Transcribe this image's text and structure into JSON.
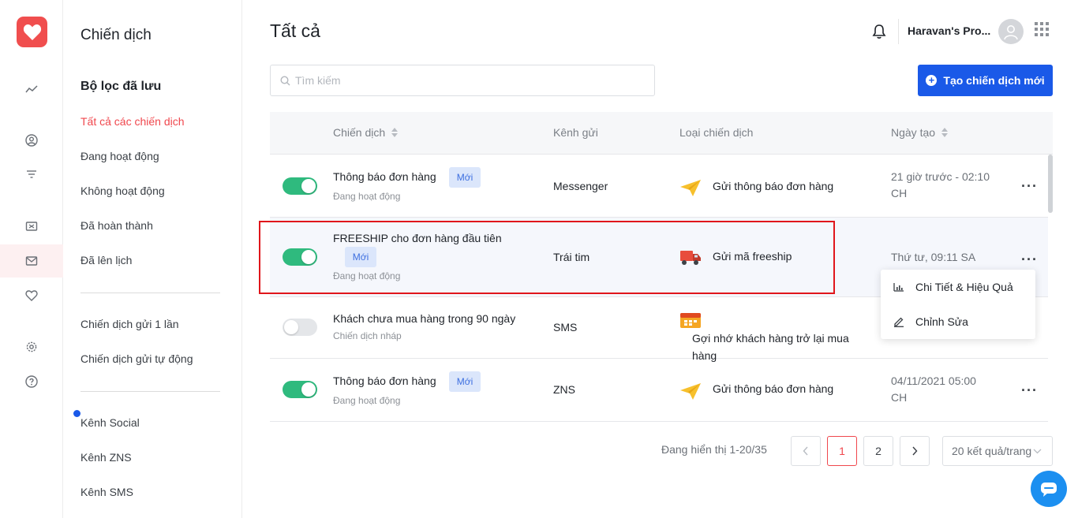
{
  "sidebar": {
    "title": "Chiến dịch",
    "saved_filters_title": "Bộ lọc đã lưu",
    "items": [
      {
        "label": "Tất cả các chiến dịch",
        "active": true
      },
      {
        "label": "Đang hoạt động"
      },
      {
        "label": "Không hoạt động"
      },
      {
        "label": "Đã hoàn thành"
      },
      {
        "label": "Đã lên lịch"
      }
    ],
    "group2": [
      {
        "label": "Chiến dịch gửi 1 lần"
      },
      {
        "label": "Chiến dịch gửi tự động"
      }
    ],
    "group3": [
      {
        "label": "Kênh Social"
      },
      {
        "label": "Kênh ZNS"
      },
      {
        "label": "Kênh SMS"
      }
    ]
  },
  "header": {
    "title": "Tất cả",
    "store_name": "Haravan's Pro..."
  },
  "search": {
    "placeholder": "Tìm kiếm"
  },
  "create_button": {
    "label": "Tạo chiến dịch mới"
  },
  "table": {
    "columns": [
      "Chiến dịch",
      "Kênh gửi",
      "Loại chiến dịch",
      "Ngày tạo"
    ],
    "rows": [
      {
        "name": "Thông báo đơn hàng",
        "badge": "Mới",
        "status": "Đang hoạt động",
        "channel": "Messenger",
        "type": "Gửi thông báo đơn hàng",
        "type_icon": "paper-plane-icon",
        "date": "21 giờ trước - 02:10 CH",
        "enabled": true
      },
      {
        "name": "FREESHIP cho đơn hàng đầu tiên",
        "badge": "Mới",
        "status": "Đang hoạt động",
        "channel": "Trái tim",
        "type": "Gửi mã freeship",
        "type_icon": "truck-icon",
        "date": "Thứ tư, 09:11 SA",
        "enabled": true
      },
      {
        "name": "Khách chưa mua hàng trong 90 ngày",
        "badge": "",
        "status": "Chiến dịch nháp",
        "channel": "SMS",
        "type": "Gợi nhớ khách hàng trở lại mua hàng",
        "type_icon": "calendar-icon",
        "date": "",
        "enabled": false
      },
      {
        "name": "Thông báo đơn hàng",
        "badge": "Mới",
        "status": "Đang hoạt động",
        "channel": "ZNS",
        "type": "Gửi thông báo đơn hàng",
        "type_icon": "paper-plane-icon",
        "date": "04/11/2021 05:00 CH",
        "enabled": true
      }
    ]
  },
  "context_menu": {
    "items": [
      {
        "label": "Chi Tiết & Hiệu Quả",
        "icon": "bar-chart-icon"
      },
      {
        "label": "Chỉnh Sửa",
        "icon": "edit-icon"
      }
    ]
  },
  "pagination": {
    "info": "Đang hiển thị 1-20/35",
    "pages": [
      "1",
      "2"
    ],
    "current": "1",
    "page_size": "20 kết quả/trang"
  },
  "colors": {
    "accent": "#f0474d",
    "primary": "#1a59e8",
    "toggle_on": "#2fba7e",
    "highlight_border": "#e0161b"
  }
}
